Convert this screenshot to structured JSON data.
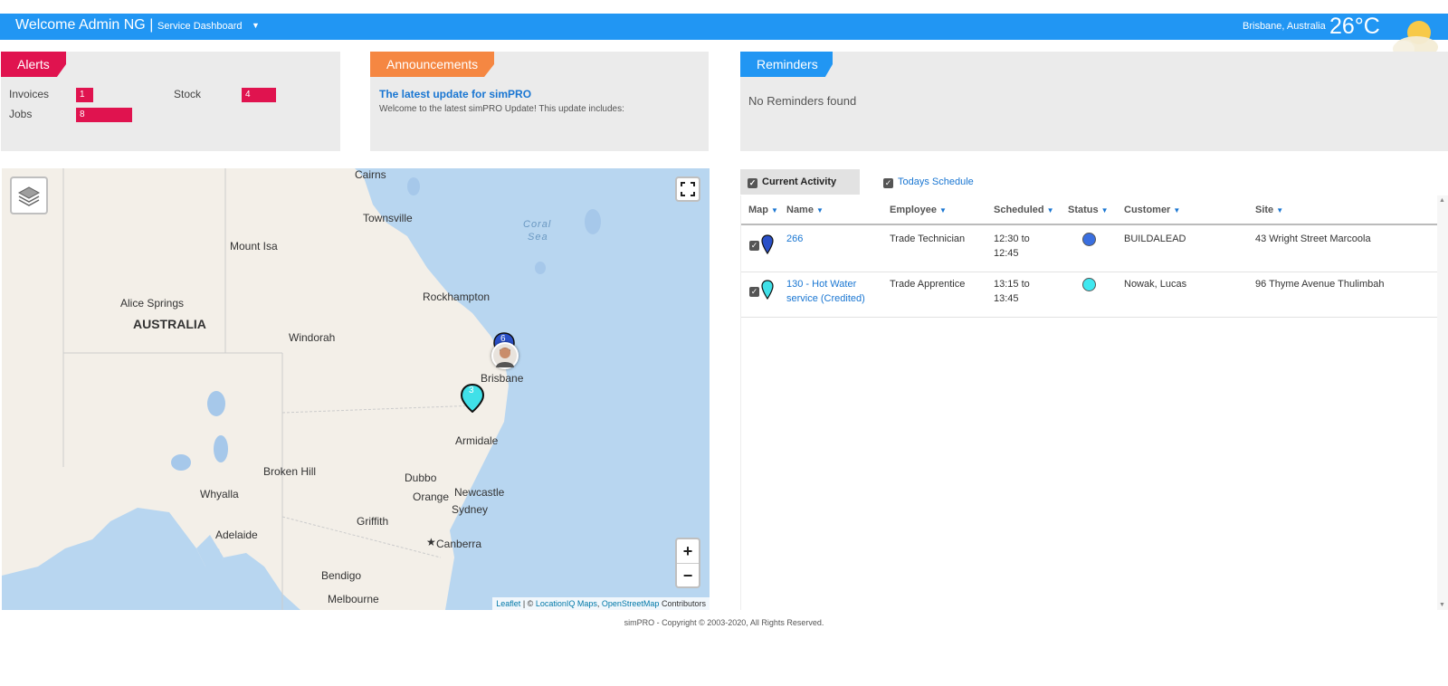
{
  "header": {
    "welcome": "Welcome Admin NG |",
    "dashboard_select": "Service Dashboard",
    "caret": "▼",
    "location": "Brisbane, Australia",
    "temperature": "26°C",
    "weather_icon": "partly-sunny-icon"
  },
  "alerts": {
    "title": "Alerts",
    "items": [
      {
        "label": "Invoices",
        "count": "1"
      },
      {
        "label": "Stock",
        "count": "4"
      },
      {
        "label": "Jobs",
        "count": "8"
      }
    ]
  },
  "announcements": {
    "title": "Announcements",
    "headline": "The latest update for simPRO",
    "text": "Welcome to the latest simPRO Update! This update includes:"
  },
  "reminders": {
    "title": "Reminders",
    "empty_text": "No Reminders found"
  },
  "map": {
    "labels": {
      "cairns": "Cairns",
      "townsville": "Townsville",
      "coral_sea_1": "Coral",
      "coral_sea_2": "Sea",
      "mount_isa": "Mount Isa",
      "alice_springs": "Alice Springs",
      "australia": "AUSTRALIA",
      "rockhampton": "Rockhampton",
      "windorah": "Windorah",
      "brisbane": "Brisbane",
      "armidale": "Armidale",
      "broken_hill": "Broken Hill",
      "dubbo": "Dubbo",
      "newcastle": "Newcastle",
      "whyalla": "Whyalla",
      "orange": "Orange",
      "sydney": "Sydney",
      "griffith": "Griffith",
      "adelaide": "Adelaide",
      "canberra": "Canberra",
      "bendigo": "Bendigo",
      "melbourne": "Melbourne"
    },
    "markers": [
      {
        "label": "6",
        "color": "#2a50c8"
      },
      {
        "label": "3",
        "color": "#40e0e8"
      }
    ],
    "zoom_in": "+",
    "zoom_out": "−",
    "attribution": {
      "leaflet": "Leaflet",
      "sep": "| ©",
      "locationiq": "LocationIQ Maps",
      "comma": ",",
      "osm": "OpenStreetMap",
      "contributors": "Contributors"
    }
  },
  "activity": {
    "tabs": [
      {
        "label": "Current Activity",
        "checked": true
      },
      {
        "label": "Todays Schedule",
        "checked": true
      }
    ],
    "columns": [
      "Map",
      "Name",
      "Employee",
      "Scheduled",
      "Status",
      "Customer",
      "Site"
    ],
    "rows": [
      {
        "name": "266",
        "employee": "Trade Technician",
        "scheduled_1": "12:30 to",
        "scheduled_2": "12:45",
        "status_color": "#3a6fe0",
        "customer": "BUILDALEAD",
        "site": "43 Wright Street Marcoola",
        "pin_color": "#2a50c8"
      },
      {
        "name_1": "130 - Hot Water",
        "name_2": "service (Credited)",
        "employee": "Trade Apprentice",
        "scheduled_1": "13:15 to",
        "scheduled_2": "13:45",
        "status_color": "#40e8f0",
        "customer": "Nowak, Lucas",
        "site": "96 Thyme Avenue Thulimbah",
        "pin_color": "#40e0e8"
      }
    ]
  },
  "footer": "simPRO - Copyright © 2003-2020, All Rights Reserved."
}
